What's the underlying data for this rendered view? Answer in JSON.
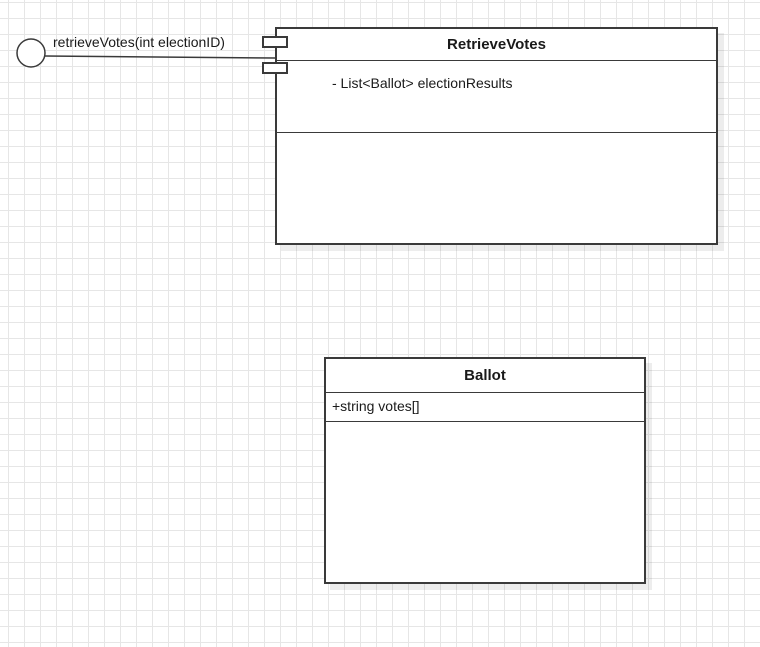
{
  "diagram": {
    "interface": {
      "label": "retrieveVotes(int electionID)"
    },
    "classes": {
      "retrieve_votes": {
        "name": "RetrieveVotes",
        "attributes": [
          "- List<Ballot> electionResults"
        ]
      },
      "ballot": {
        "name": "Ballot",
        "attributes": [
          "+string votes[]"
        ]
      }
    }
  }
}
